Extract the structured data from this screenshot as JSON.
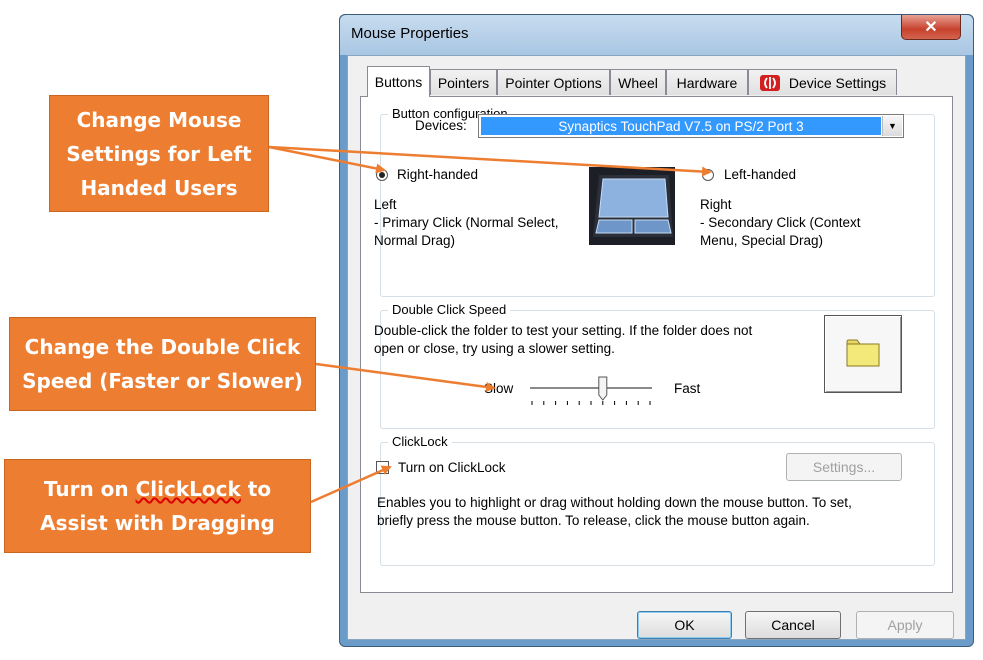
{
  "window": {
    "title": "Mouse Properties",
    "close_glyph": "✕"
  },
  "tabs": [
    {
      "label": "Buttons"
    },
    {
      "label": "Pointers"
    },
    {
      "label": "Pointer Options"
    },
    {
      "label": "Wheel"
    },
    {
      "label": "Hardware"
    },
    {
      "label": "Device Settings"
    }
  ],
  "button_config": {
    "legend": "Button configuration",
    "devices_label": "Devices:",
    "device_value": "Synaptics TouchPad V7.5 on PS/2 Port 3",
    "right_handed_label": "Right-handed",
    "left_handed_label": "Left-handed",
    "selected": "right-handed",
    "left_title": "Left",
    "left_desc": " - Primary Click (Normal Select,\nNormal Drag)",
    "right_title": "Right",
    "right_desc": " - Secondary Click (Context\nMenu, Special Drag)"
  },
  "double_click": {
    "legend": "Double Click Speed",
    "desc": "Double-click the folder to test your setting.  If the folder does not\nopen or close, try using a slower setting.",
    "slow_label": "Slow",
    "fast_label": "Fast",
    "speed_level": 0.6
  },
  "clicklock": {
    "legend": "ClickLock",
    "checkbox_label": "Turn on ClickLock",
    "checked": false,
    "settings_label": "Settings...",
    "desc": "Enables you to highlight or drag without holding down the mouse button.  To set,\nbriefly press the mouse button.  To release, click the mouse button again."
  },
  "footer": {
    "ok_label": "OK",
    "cancel_label": "Cancel",
    "apply_label": "Apply"
  },
  "callouts": [
    {
      "text": "Change Mouse\nSettings for Left\nHanded Users"
    },
    {
      "text": "Change the Double Click\nSpeed (Faster or Slower)"
    },
    {
      "prefix": "Turn on ",
      "underlined": "ClickLock",
      "suffix": " to\nAssist with Dragging"
    }
  ],
  "colors": {
    "callout": "#ED7D31",
    "arrow": "#ED7D31",
    "selection": "#3399ff"
  }
}
